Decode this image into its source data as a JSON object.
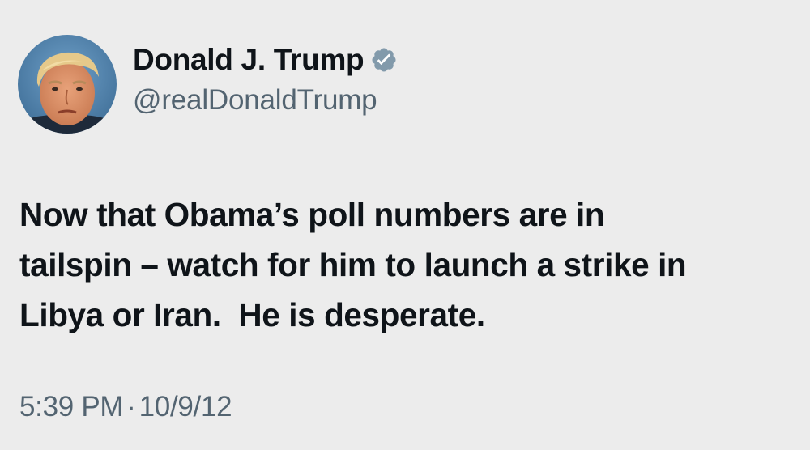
{
  "author": {
    "display_name": "Donald J. Trump",
    "handle": "@realDonaldTrump",
    "verified": true,
    "verified_badge_color": "#829aab",
    "avatar_icon": "profile-photo"
  },
  "tweet": {
    "text": "Now that Obama’s poll numbers are in\ntailspin – watch for him to launch a strike in\nLibya or Iran.  He is desperate.",
    "time": "5:39 PM",
    "separator": "·",
    "date": "10/9/12"
  },
  "colors": {
    "background": "#ececec",
    "primary_text": "#0f1419",
    "secondary_text": "#536471"
  }
}
